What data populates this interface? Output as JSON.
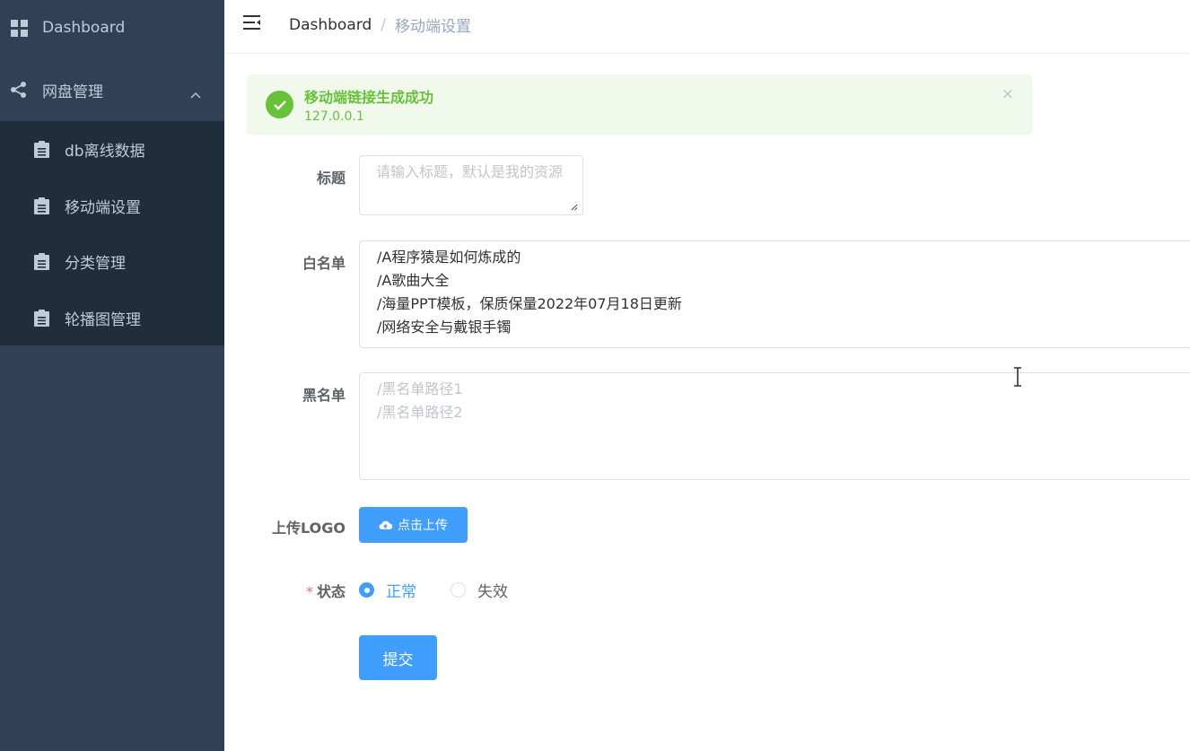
{
  "sidebar": {
    "items": [
      {
        "label": "Dashboard",
        "icon": "grid-icon"
      },
      {
        "label": "网盘管理",
        "icon": "share-icon",
        "expanded": true
      }
    ],
    "submenu": [
      {
        "label": "db离线数据",
        "icon": "clipboard-icon"
      },
      {
        "label": "移动端设置",
        "icon": "clipboard-icon"
      },
      {
        "label": "分类管理",
        "icon": "clipboard-icon"
      },
      {
        "label": "轮播图管理",
        "icon": "clipboard-icon"
      }
    ]
  },
  "breadcrumb": {
    "home": "Dashboard",
    "separator": "/",
    "current": "移动端设置"
  },
  "alert": {
    "title": "移动端链接生成成功",
    "description": "127.0.0.1",
    "close": "×"
  },
  "form": {
    "title_label": "标题",
    "title_placeholder": "请输入标题，默认是我的资源",
    "whitelist_label": "白名单",
    "whitelist_value": "/A程序猿是如何炼成的\n/A歌曲大全\n/海量PPT模板，保质保量2022年07月18日更新\n/网络安全与戴银手镯",
    "blacklist_label": "黑名单",
    "blacklist_placeholder": "/黑名单路径1\n/黑名单路径2",
    "logo_label": "上传LOGO",
    "upload_button": "点击上传",
    "status_required": "*",
    "status_label": "状态",
    "status_options": [
      {
        "label": "正常",
        "selected": true
      },
      {
        "label": "失效",
        "selected": false
      }
    ],
    "submit_button": "提交"
  },
  "colors": {
    "sidebar_bg": "#304156",
    "submenu_bg": "#1f2d3d",
    "primary": "#409eff",
    "success": "#67c23a",
    "success_bg": "#f0f9eb"
  }
}
